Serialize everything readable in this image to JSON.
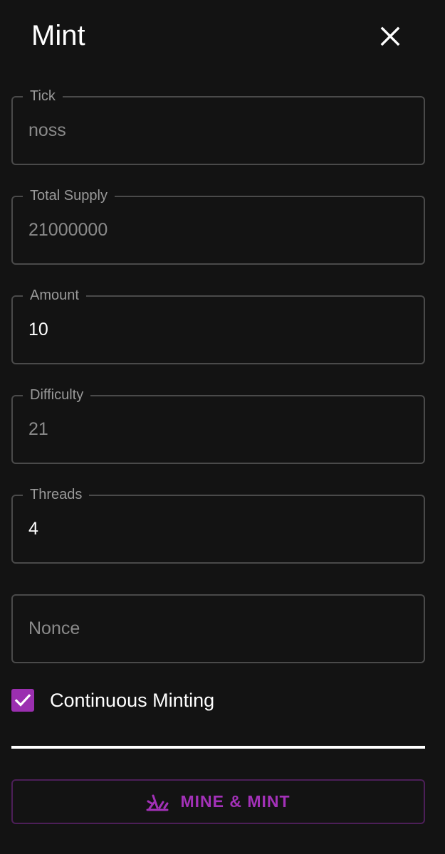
{
  "header": {
    "title": "Mint"
  },
  "fields": {
    "tick": {
      "label": "Tick",
      "value": "noss"
    },
    "total_supply": {
      "label": "Total Supply",
      "value": "21000000"
    },
    "amount": {
      "label": "Amount",
      "value": "10"
    },
    "difficulty": {
      "label": "Difficulty",
      "value": "21"
    },
    "threads": {
      "label": "Threads",
      "value": "4"
    },
    "nonce": {
      "placeholder": "Nonce",
      "value": ""
    }
  },
  "continuous_minting": {
    "label": "Continuous Minting",
    "checked": true
  },
  "mine_button": {
    "label": "MINE & MINT",
    "icon": "mining-icon"
  },
  "colors": {
    "background": "#131313",
    "accent": "#9b2fb0",
    "button_text": "#a331b8",
    "border": "#4a4a4a"
  }
}
